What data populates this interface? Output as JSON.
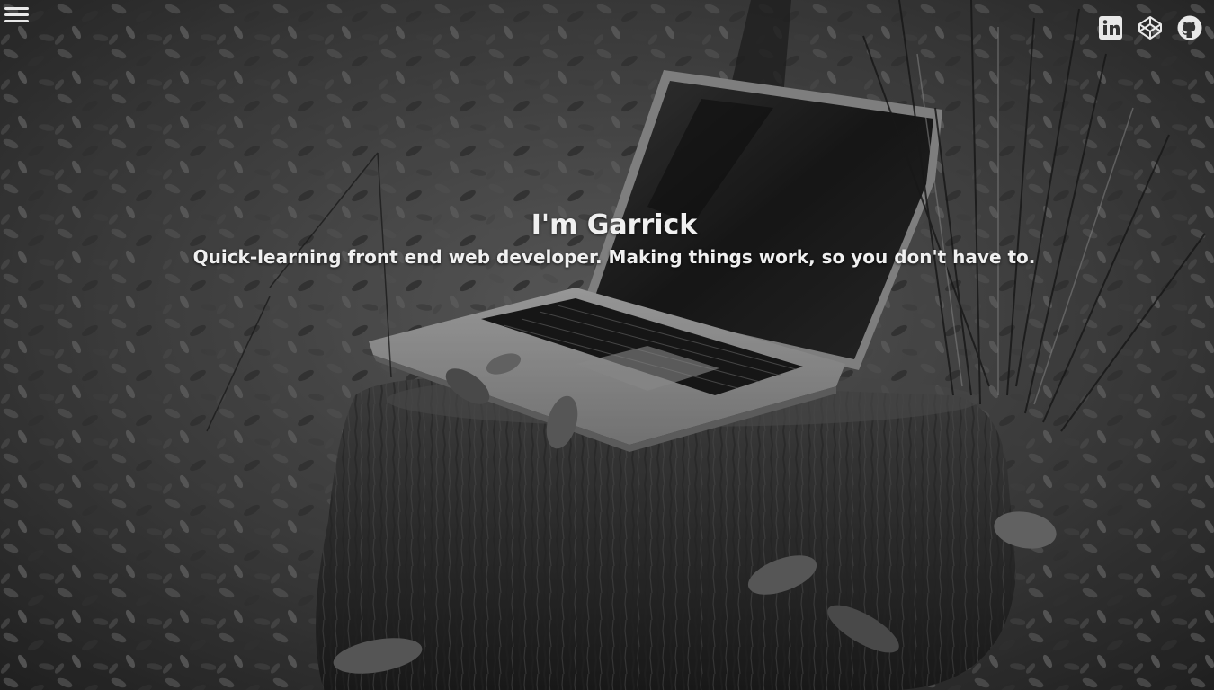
{
  "hero": {
    "background_image": "laptop-on-tree-stump-grayscale-photo",
    "title": "I'm Garrick",
    "subtitle": "Quick-learning front end web developer. Making things work, so you don't have to."
  },
  "nav": {
    "menu_icon": "hamburger-menu-icon"
  },
  "social": {
    "items": [
      {
        "name": "LinkedIn",
        "icon": "linkedin-icon"
      },
      {
        "name": "CodePen",
        "icon": "codepen-icon"
      },
      {
        "name": "GitHub",
        "icon": "github-icon"
      }
    ]
  },
  "colors": {
    "text": "#f0f0f0",
    "icon": "#e8e8e8"
  }
}
